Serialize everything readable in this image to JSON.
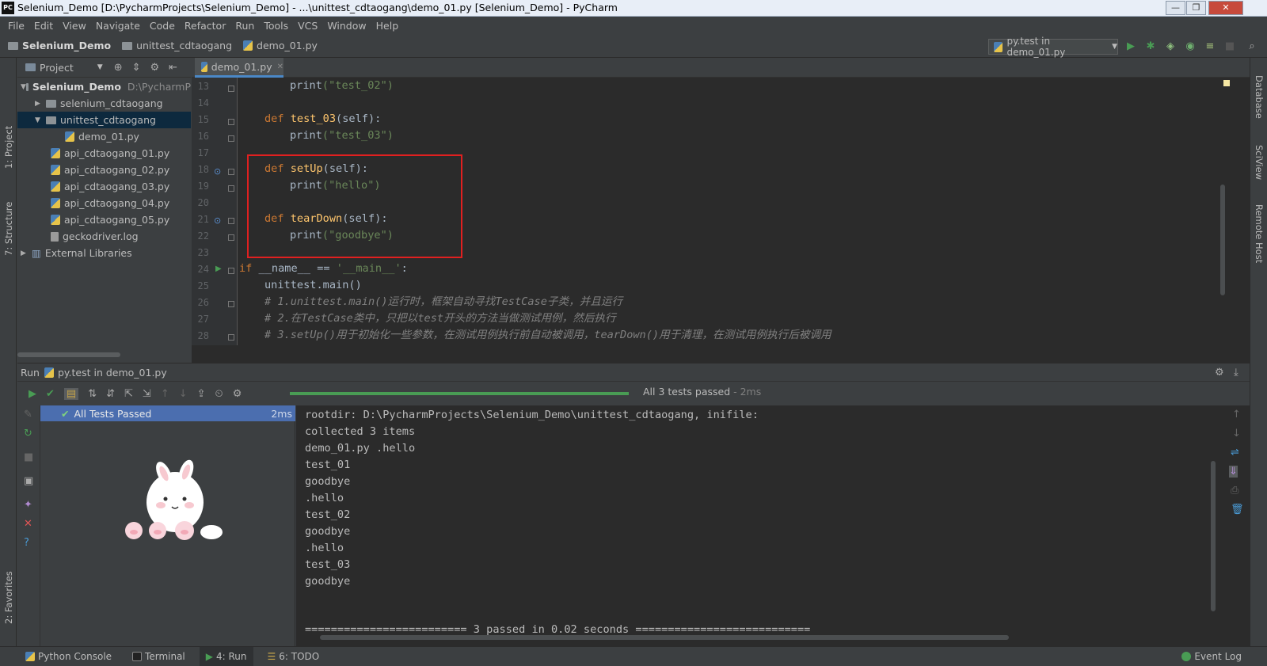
{
  "title": "Selenium_Demo [D:\\PycharmProjects\\Selenium_Demo] - ...\\unittest_cdtaogang\\demo_01.py [Selenium_Demo] - PyCharm",
  "menu": [
    "File",
    "Edit",
    "View",
    "Navigate",
    "Code",
    "Refactor",
    "Run",
    "Tools",
    "VCS",
    "Window",
    "Help"
  ],
  "breadcrumbs": [
    "Selenium_Demo",
    "unittest_cdtaogang",
    "demo_01.py"
  ],
  "run_config": "py.test in demo_01.py",
  "left_tabs": [
    "1: Project",
    "7: Structure",
    "2: Favorites"
  ],
  "right_tabs": [
    "Database",
    "SciView",
    "Remote Host"
  ],
  "project": {
    "header": "Project",
    "root_name": "Selenium_Demo",
    "root_path": "D:\\PycharmP",
    "items": [
      {
        "label": "selenium_cdtaogang",
        "kind": "folder",
        "expanded": false
      },
      {
        "label": "unittest_cdtaogang",
        "kind": "folder",
        "expanded": true
      },
      {
        "label": "demo_01.py",
        "kind": "py"
      },
      {
        "label": "api_cdtaogang_01.py",
        "kind": "py"
      },
      {
        "label": "api_cdtaogang_02.py",
        "kind": "py"
      },
      {
        "label": "api_cdtaogang_03.py",
        "kind": "py"
      },
      {
        "label": "api_cdtaogang_04.py",
        "kind": "py"
      },
      {
        "label": "api_cdtaogang_05.py",
        "kind": "py"
      },
      {
        "label": "geckodriver.log",
        "kind": "log"
      },
      {
        "label": "External Libraries",
        "kind": "lib"
      }
    ]
  },
  "editor": {
    "tab": "demo_01.py",
    "line_numbers": [
      "13",
      "14",
      "15",
      "16",
      "17",
      "18",
      "19",
      "20",
      "21",
      "22",
      "23",
      "24",
      "25",
      "26",
      "27",
      "28"
    ],
    "code": {
      "l13_print": "print",
      "l13_str": "(\"test_02\")",
      "l15_def": "def",
      "l15_fn": "test_03",
      "l15_args": "(self):",
      "l16_print": "print",
      "l16_str": "(\"test_03\")",
      "l18_def": "def",
      "l18_fn": "setUp",
      "l18_args": "(self):",
      "l19_print": "print",
      "l19_str": "(\"hello\")",
      "l21_def": "def",
      "l21_fn": "tearDown",
      "l21_args": "(self):",
      "l22_print": "print",
      "l22_str": "(\"goodbye\")",
      "l24_if": "if",
      "l24_rest": " __name__ == ",
      "l24_str": "'__main__'",
      "l24_end": ":",
      "l25": "unittest.main()",
      "l26": "# 1.unittest.main()运行时，框架自动寻找TestCase子类，并且运行",
      "l27": "# 2.在TestCase类中，只把以test开头的方法当做测试用例，然后执行",
      "l28": "# 3.setUp()用于初始化一些参数，在测试用例执行前自动被调用，tearDown()用于清理，在测试用例执行后被调用"
    }
  },
  "run": {
    "header_prefix": "Run",
    "header_config": "py.test in demo_01.py",
    "status": "All 3 tests passed",
    "status_time": " - 2ms",
    "progress": 1.0,
    "tree_item": "All Tests Passed",
    "tree_time": "2ms",
    "console": [
      "rootdir: D:\\PycharmProjects\\Selenium_Demo\\unittest_cdtaogang, inifile:",
      "collected 3 items",
      "demo_01.py .hello",
      "test_01",
      "goodbye",
      ".hello",
      "test_02",
      "goodbye",
      ".hello",
      "test_03",
      "goodbye"
    ],
    "summary": "========================= 3 passed in 0.02 seconds ==========================="
  },
  "statusbar": {
    "python_console": "Python Console",
    "terminal": "Terminal",
    "run": "4: Run",
    "todo": "6: TODO",
    "event_log": "Event Log"
  },
  "colors": {
    "keyword": "#cc7832",
    "string": "#6a8759",
    "function": "#ffc66d",
    "comment": "#808080",
    "highlight_box": "#e02020",
    "selection": "#4b6eaf",
    "progress": "#499c54"
  }
}
